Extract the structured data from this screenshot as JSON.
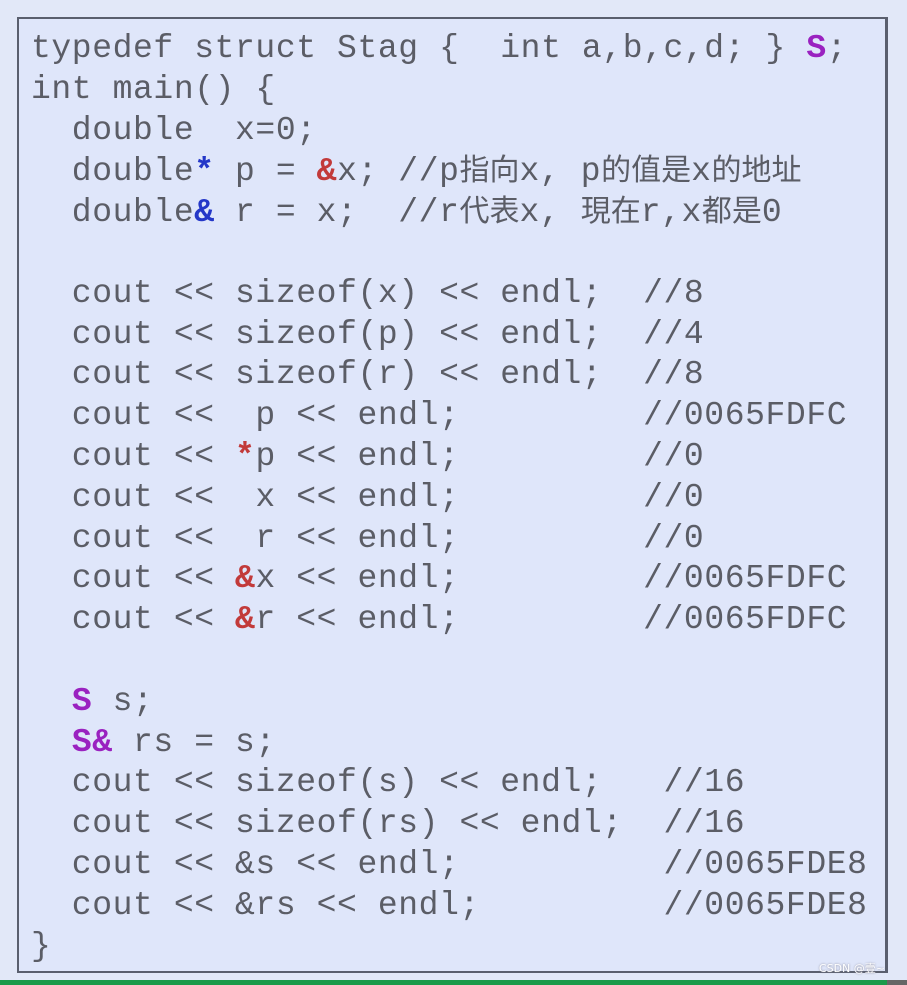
{
  "code_lines": [
    [
      {
        "t": "typedef struct Stag {  int a,b,c,d; } "
      },
      {
        "t": "S",
        "c": "purple"
      },
      {
        "t": ";"
      }
    ],
    [
      {
        "t": "int main() {"
      }
    ],
    [
      {
        "t": "  double  x=0;"
      }
    ],
    [
      {
        "t": "  double"
      },
      {
        "t": "*",
        "c": "blue"
      },
      {
        "t": " p = "
      },
      {
        "t": "&",
        "c": "red"
      },
      {
        "t": "x; //p"
      },
      {
        "t": "指向",
        "c": "cjk"
      },
      {
        "t": "x, p"
      },
      {
        "t": "的值是",
        "c": "cjk"
      },
      {
        "t": "x"
      },
      {
        "t": "的地址",
        "c": "cjk"
      }
    ],
    [
      {
        "t": "  double"
      },
      {
        "t": "&",
        "c": "blue"
      },
      {
        "t": " r = x;  //r"
      },
      {
        "t": "代表",
        "c": "cjk"
      },
      {
        "t": "x, "
      },
      {
        "t": "現在",
        "c": "cjk"
      },
      {
        "t": "r,x"
      },
      {
        "t": "都是",
        "c": "cjk"
      },
      {
        "t": "0"
      }
    ],
    [],
    [
      {
        "t": "  cout << sizeof(x) << endl;  //8"
      }
    ],
    [
      {
        "t": "  cout << sizeof(p) << endl;  //4"
      }
    ],
    [
      {
        "t": "  cout << sizeof(r) << endl;  //8"
      }
    ],
    [
      {
        "t": "  cout <<  p << endl;         //0065FDFC"
      }
    ],
    [
      {
        "t": "  cout << "
      },
      {
        "t": "*",
        "c": "red"
      },
      {
        "t": "p << endl;         //0"
      }
    ],
    [
      {
        "t": "  cout <<  x << endl;         //0"
      }
    ],
    [
      {
        "t": "  cout <<  r << endl;         //0"
      }
    ],
    [
      {
        "t": "  cout << "
      },
      {
        "t": "&",
        "c": "red"
      },
      {
        "t": "x << endl;         //0065FDFC"
      }
    ],
    [
      {
        "t": "  cout << "
      },
      {
        "t": "&",
        "c": "red"
      },
      {
        "t": "r << endl;         //0065FDFC"
      }
    ],
    [],
    [
      {
        "t": "  "
      },
      {
        "t": "S",
        "c": "purple"
      },
      {
        "t": " s;"
      }
    ],
    [
      {
        "t": "  "
      },
      {
        "t": "S&",
        "c": "purple"
      },
      {
        "t": " rs = s;"
      }
    ],
    [
      {
        "t": "  cout << sizeof(s) << endl;   //16"
      }
    ],
    [
      {
        "t": "  cout << sizeof(rs) << endl;  //16"
      }
    ],
    [
      {
        "t": "  cout << &s << endl;          //0065FDE8"
      }
    ],
    [
      {
        "t": "  cout << &rs << endl;         //0065FDE8"
      }
    ],
    [
      {
        "t": "}"
      }
    ]
  ],
  "watermark": "CSDN @壹~",
  "colors": {
    "background": "#dfe6fa",
    "text": "#5b5d66",
    "pointer": "#2437c8",
    "address": "#c23a3a",
    "type": "#9a22c0"
  }
}
